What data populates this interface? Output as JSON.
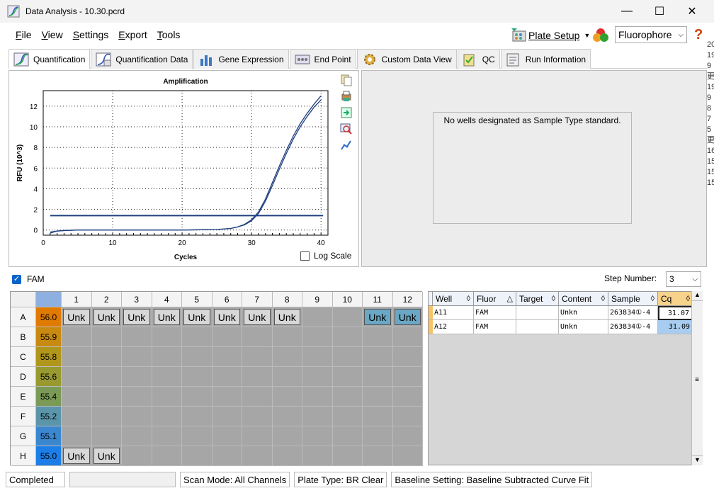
{
  "window": {
    "title": "Data Analysis - 10.30.pcrd",
    "minimize": "—",
    "maximize": "☐",
    "close": "✕"
  },
  "menu": [
    "File",
    "View",
    "Settings",
    "Export",
    "Tools"
  ],
  "menu_accel": [
    "F",
    "V",
    "S",
    "E",
    "T"
  ],
  "toolbar": {
    "plate_setup": "Plate Setup",
    "fluorophore": "Fluorophore",
    "help": "?"
  },
  "tabs": [
    {
      "label": "Quantification",
      "icon": "amplification-chart-icon"
    },
    {
      "label": "Quantification Data",
      "icon": "data-chart-icon"
    },
    {
      "label": "Gene Expression",
      "icon": "bar-chart-icon"
    },
    {
      "label": "End Point",
      "icon": "endpoint-icon"
    },
    {
      "label": "Custom Data View",
      "icon": "gear-icon"
    },
    {
      "label": "QC",
      "icon": "qc-icon"
    },
    {
      "label": "Run Information",
      "icon": "run-info-icon"
    }
  ],
  "chart_data": {
    "type": "line",
    "title": "Amplification",
    "xlabel": "Cycles",
    "ylabel": "RFU (10^3)",
    "xlim": [
      0,
      41
    ],
    "ylim": [
      -0.5,
      13.5
    ],
    "xticks": [
      0,
      10,
      20,
      30,
      40
    ],
    "yticks": [
      0,
      2,
      4,
      6,
      8,
      10,
      12
    ],
    "grid": true,
    "threshold": 1.4,
    "series": [
      {
        "x": [
          1,
          2,
          3,
          5,
          8,
          10,
          15,
          20,
          25,
          27,
          28,
          29,
          30,
          31,
          32,
          33,
          34,
          35,
          36,
          37,
          38,
          39,
          40
        ],
        "values": [
          -0.3,
          -0.1,
          -0.05,
          0,
          0,
          0,
          0,
          0,
          0.05,
          0.15,
          0.3,
          0.5,
          0.9,
          1.6,
          2.8,
          4.3,
          5.9,
          7.4,
          8.8,
          10,
          11,
          11.9,
          12.6
        ]
      },
      {
        "x": [
          1,
          2,
          3,
          5,
          8,
          10,
          15,
          20,
          25,
          27,
          28,
          29,
          30,
          31,
          32,
          33,
          34,
          35,
          36,
          37,
          38,
          39,
          40
        ],
        "values": [
          -0.2,
          -0.1,
          -0.05,
          0,
          0,
          0,
          0,
          0,
          0.05,
          0.15,
          0.3,
          0.55,
          1.0,
          1.75,
          3.0,
          4.6,
          6.2,
          7.7,
          9.1,
          10.3,
          11.3,
          12.2,
          13.0
        ]
      }
    ],
    "color": "#1f3f80",
    "threshold_color": "#1f3f80"
  },
  "log_scale_label": "Log Scale",
  "standard_message": "No wells designated as Sample Type standard.",
  "fluor_filter": {
    "label": "FAM",
    "checked": true
  },
  "step": {
    "label": "Step Number:",
    "value": "3"
  },
  "plate": {
    "columns": [
      "1",
      "2",
      "3",
      "4",
      "5",
      "6",
      "7",
      "8",
      "9",
      "10",
      "11",
      "12"
    ],
    "rows": [
      "A",
      "B",
      "C",
      "D",
      "E",
      "F",
      "G",
      "H"
    ],
    "temps": [
      "56.0",
      "55.9",
      "55.8",
      "55.6",
      "55.4",
      "55.2",
      "55.1",
      "55.0"
    ],
    "temp_colors": [
      "#e07a00",
      "#c88a10",
      "#b0961a",
      "#989a30",
      "#7a9a55",
      "#5a95aa",
      "#3a87d0",
      "#1d7ee8"
    ],
    "wells": {
      "A1": "Unk",
      "A2": "Unk",
      "A3": "Unk",
      "A4": "Unk",
      "A5": "Unk",
      "A6": "Unk",
      "A7": "Unk",
      "A8": "Unk",
      "A11": "Unk",
      "A12": "Unk",
      "H1": "Unk",
      "H2": "Unk"
    },
    "selected": [
      "A11",
      "A12"
    ]
  },
  "well_table": {
    "columns": [
      "Well",
      "Fluor",
      "Target",
      "Content",
      "Sample",
      "Cq"
    ],
    "rows": [
      [
        "A11",
        "FAM",
        "",
        "Unkn",
        "263834①-4",
        "31.07"
      ],
      [
        "A12",
        "FAM",
        "",
        "Unkn",
        "263834①-4",
        "31.09"
      ]
    ]
  },
  "status": {
    "state": "Completed",
    "scan_mode": "Scan Mode: All Channels",
    "plate_type": "Plate Type: BR Clear",
    "baseline": "Baseline Setting: Baseline Subtracted Curve Fit"
  },
  "edge_glyphs": [
    "20",
    "19",
    "9",
    "更",
    "19",
    "9",
    "8",
    "7",
    "5",
    "更",
    "16",
    "15",
    "15",
    "15"
  ]
}
